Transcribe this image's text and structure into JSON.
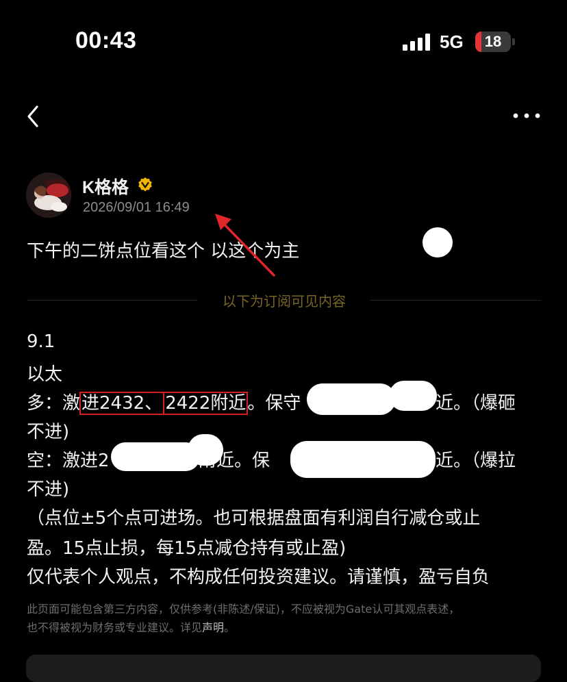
{
  "status_bar": {
    "time": "00:43",
    "network": "5G",
    "battery": "18",
    "battery_level_percent": 18,
    "battery_color": "#e5333a",
    "icons": [
      "signal-icon",
      "battery-icon"
    ]
  },
  "nav": {
    "back_icon": "back-chevron-icon",
    "more_icon": "more-ellipsis-icon"
  },
  "author": {
    "name": "K格格",
    "verified_icon": "verified-badge-icon",
    "verified_color": "#f2b705",
    "timestamp": "2026/09/01 16:49"
  },
  "post": {
    "intro": "下午的二饼点位看这个 以这个为主",
    "subscriber_divider": "以下为订阅可见内容",
    "date": "9.1",
    "asset": "以太",
    "long_prefix": "多：激",
    "long_level_1": "进2432、",
    "long_level_2": "2422附近",
    "long_after": "。保守",
    "long_end": "近。（爆砸",
    "long_cont": "不进)",
    "short_prefix": "空：激进2",
    "short_mid": "附近。保",
    "short_end": "近。（爆拉",
    "short_cont": "不进)",
    "note_line_1": "（点位±5个点可进场。也可根据盘面有利润自行减仓或止",
    "note_line_2": "盈。15点止损，每15点减仓持有或止盈)",
    "risk_line": "仅代表个人观点，不构成任何投资建议。请谨慎，盈亏自负"
  },
  "disclaimer": {
    "text_1": "此页面可能包含第三方内容，仅供参考(非陈述/保证)，不应被视为Gate认可其观点表述，",
    "text_2": "也不得被视为财务或专业建议。详见",
    "link": "声明",
    "text_end": "。"
  },
  "colors": {
    "background": "#000000",
    "highlight_box": "#d42020",
    "annotation_arrow": "#e0262b",
    "divider_text": "#7a6526"
  }
}
